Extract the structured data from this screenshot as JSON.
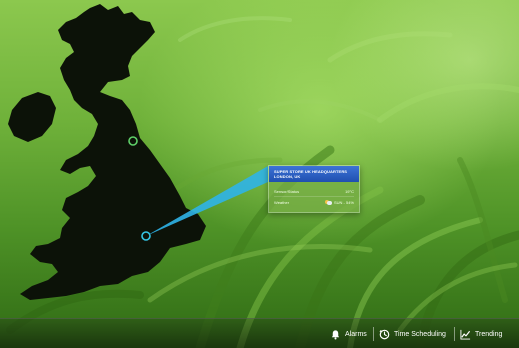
{
  "callout": {
    "title": "SUPER STORE UK HEADQUARTERS",
    "subtitle": "LONDON, UK",
    "rows": [
      {
        "label": "Sensor/Status",
        "value": "19°C"
      },
      {
        "label": "Weather",
        "value": "SUN - 54%",
        "icon": "partly-sunny-icon"
      }
    ]
  },
  "toolbar": {
    "items": [
      {
        "label": "Alarms",
        "icon": "bell-icon"
      },
      {
        "label": "Time Scheduling",
        "icon": "clock-icon"
      },
      {
        "label": "Trending",
        "icon": "trend-line-icon"
      }
    ]
  },
  "markers": [
    {
      "name": "north-site",
      "color": "#5fd069"
    },
    {
      "name": "london-headquarters",
      "color": "#35c6e6"
    }
  ],
  "colors": {
    "callout_header": "#2a5fc4",
    "callout_pointer": "#2fb4e8",
    "map_fill": "#0c1208"
  }
}
